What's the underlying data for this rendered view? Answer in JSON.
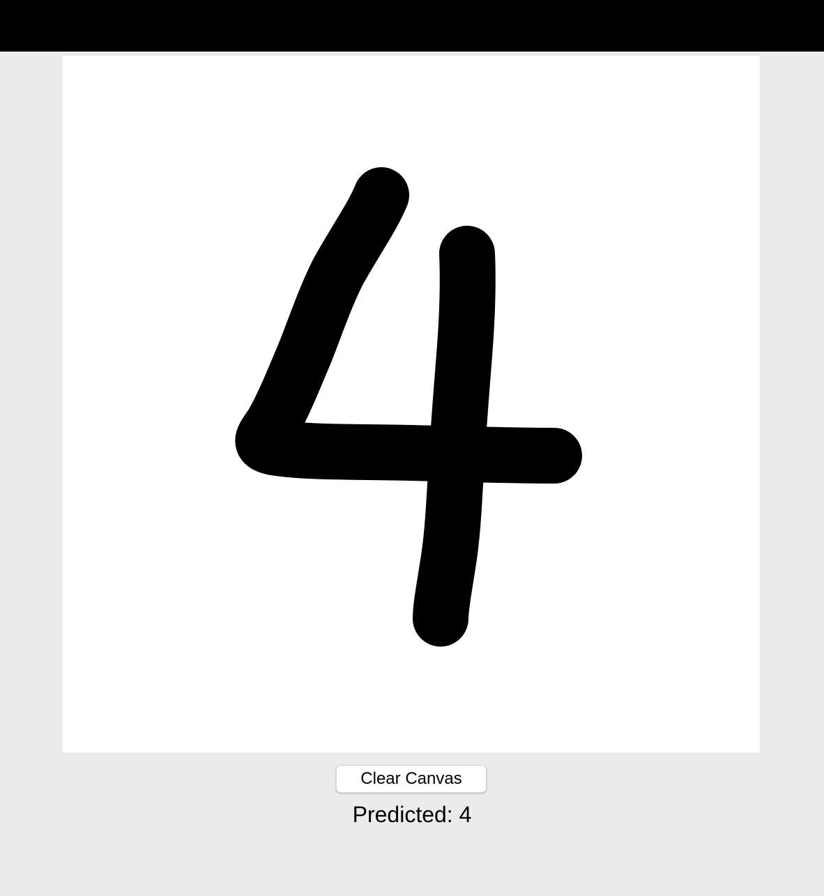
{
  "header": {
    "background_color": "#000000"
  },
  "canvas": {
    "background_color": "#ffffff",
    "ink_color": "#000000",
    "drawn_digit": "4"
  },
  "controls": {
    "clear_label": "Clear Canvas"
  },
  "result": {
    "prediction_text": "Predicted: 4"
  }
}
